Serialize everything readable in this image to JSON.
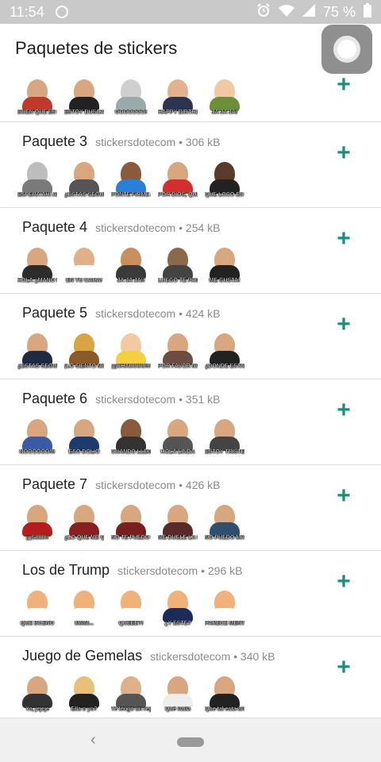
{
  "status": {
    "time": "11:54",
    "battery": "75 %"
  },
  "appbar": {
    "title": "Paquetes de stickers"
  },
  "colors": {
    "accent": "#1b8f77"
  },
  "packs": [
    {
      "name": "",
      "meta": "",
      "captions": [
        "BUEN QUE ES BROMA!",
        "ESTOY BUSCANDO",
        "OOOOOOO!",
        "HAPPY BIRTHDAY MR. PRESIDENT!",
        "JA JA JA!"
      ]
    },
    {
      "name": "Paquete 3",
      "meta": "stickersdotecom • 306 kB",
      "captions": [
        "ESPERA AHÍ AMIGO",
        "¿ESTÁS SEGURO DE ESO?",
        "PONTE FIRME AMIGO!",
        "POR DIOS, QUE DESASTRE!",
        "QUE LOCO ES ESO!"
      ]
    },
    {
      "name": "Paquete 4",
      "meta": "stickersdotecom • 254 kB",
      "captions": [
        "HOLA ¿MANO PARECE QUE HAY",
        "EN TU CARA!",
        "JA JA JA!!",
        "LUEGO TE PAGO",
        "ME GUSTA!"
      ]
    },
    {
      "name": "Paquete 5",
      "meta": "stickersdotecom • 424 kB",
      "captions": [
        "¿ESTÁS SEGURO DE ESO?",
        "¡LO SIENTO MUCHO, PERDÓNAME!",
        "¡¡¡CHAUUUU!!!",
        "POR FAVOR NO ME DEJES",
        "¿DÓNDE ESTABAS?"
      ]
    },
    {
      "name": "Paquete 6",
      "meta": "stickersdotecom • 351 kB",
      "captions": [
        "NOOOOOO!!!",
        "ESO DOLIÓ",
        "CUANDO LLEGUE YA ESTARÁ ASÍ",
        "HOLA LINDA",
        "ESTOY TRISTE"
      ]
    },
    {
      "name": "Paquete 7",
      "meta": "stickersdotecom • 426 kB",
      "captions": [
        "¡¡¡SIIIII!!!",
        "¿LO QUE ME QUERÍAS DECIR?",
        "NO TE PUEDO CREER",
        "ME DUELE LA CABEZA",
        "NO PUEDO MÁS"
      ]
    },
    {
      "name": "Los de Trump",
      "meta": "stickersdotecom • 296 kB",
      "captions": [
        "QUÉ BUENO",
        "MMM...",
        "QUEEE?!",
        "¿Y ESTE?",
        "PARECE MENTIRA"
      ]
    },
    {
      "name": "Juego de Gemelas",
      "meta": "stickersdotecom • 340 kB",
      "captions": [
        "Yo, jejeje",
        "Ella o yo?",
        "Te tengo un regalo",
        "Qué nada",
        "Que tal esta arena morena!"
      ]
    }
  ]
}
